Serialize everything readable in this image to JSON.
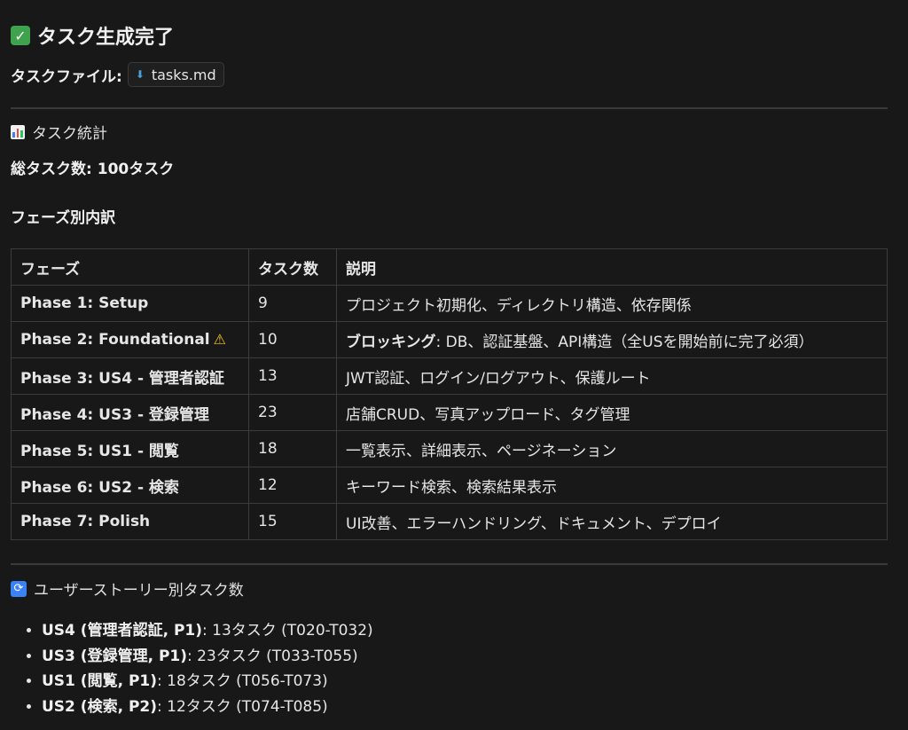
{
  "header": {
    "title": "タスク生成完了",
    "file_label": "タスクファイル:",
    "file_name": "tasks.md"
  },
  "stats": {
    "title": "タスク統計",
    "total_label": "総タスク数:",
    "total_value": "100タスク",
    "breakdown_title": "フェーズ別内訳"
  },
  "table": {
    "headers": [
      "フェーズ",
      "タスク数",
      "説明"
    ],
    "rows": [
      {
        "phase": "Phase 1: Setup",
        "count": "9",
        "desc_bold": "",
        "desc": "プロジェクト初期化、ディレクトリ構造、依存関係"
      },
      {
        "phase": "Phase 2: Foundational",
        "count": "10",
        "desc_bold": "ブロッキング",
        "desc": ": DB、認証基盤、API構造（全USを開始前に完了必須）"
      },
      {
        "phase": "Phase 3: US4 - 管理者認証",
        "count": "13",
        "desc_bold": "",
        "desc": "JWT認証、ログイン/ログアウト、保護ルート"
      },
      {
        "phase": "Phase 4: US3 - 登録管理",
        "count": "23",
        "desc_bold": "",
        "desc": "店舗CRUD、写真アップロード、タグ管理"
      },
      {
        "phase": "Phase 5: US1 - 閲覧",
        "count": "18",
        "desc_bold": "",
        "desc": "一覧表示、詳細表示、ページネーション"
      },
      {
        "phase": "Phase 6: US2 - 検索",
        "count": "12",
        "desc_bold": "",
        "desc": "キーワード検索、検索結果表示"
      },
      {
        "phase": "Phase 7: Polish",
        "count": "15",
        "desc_bold": "",
        "desc": "UI改善、エラーハンドリング、ドキュメント、デプロイ"
      }
    ]
  },
  "stories": {
    "title": "ユーザーストーリー別タスク数",
    "items": [
      {
        "label": "US4 (管理者認証, P1)",
        "text": ": 13タスク (T020-T032)"
      },
      {
        "label": "US3 (登録管理, P1)",
        "text": ": 23タスク (T033-T055)"
      },
      {
        "label": "US1 (閲覧, P1)",
        "text": ": 18タスク (T056-T073)"
      },
      {
        "label": "US2 (検索, P2)",
        "text": ": 12タスク (T074-T085)"
      }
    ]
  },
  "icons": {
    "check": "check-mark-icon",
    "file": "down-arrow-icon",
    "stats": "bar-chart-icon",
    "warning": "warning-icon",
    "stories": "refresh-icon"
  },
  "colors": {
    "background": "#181818",
    "check": "#3fa34d",
    "warning": "#f5c518",
    "refresh": "#3b82f6"
  }
}
